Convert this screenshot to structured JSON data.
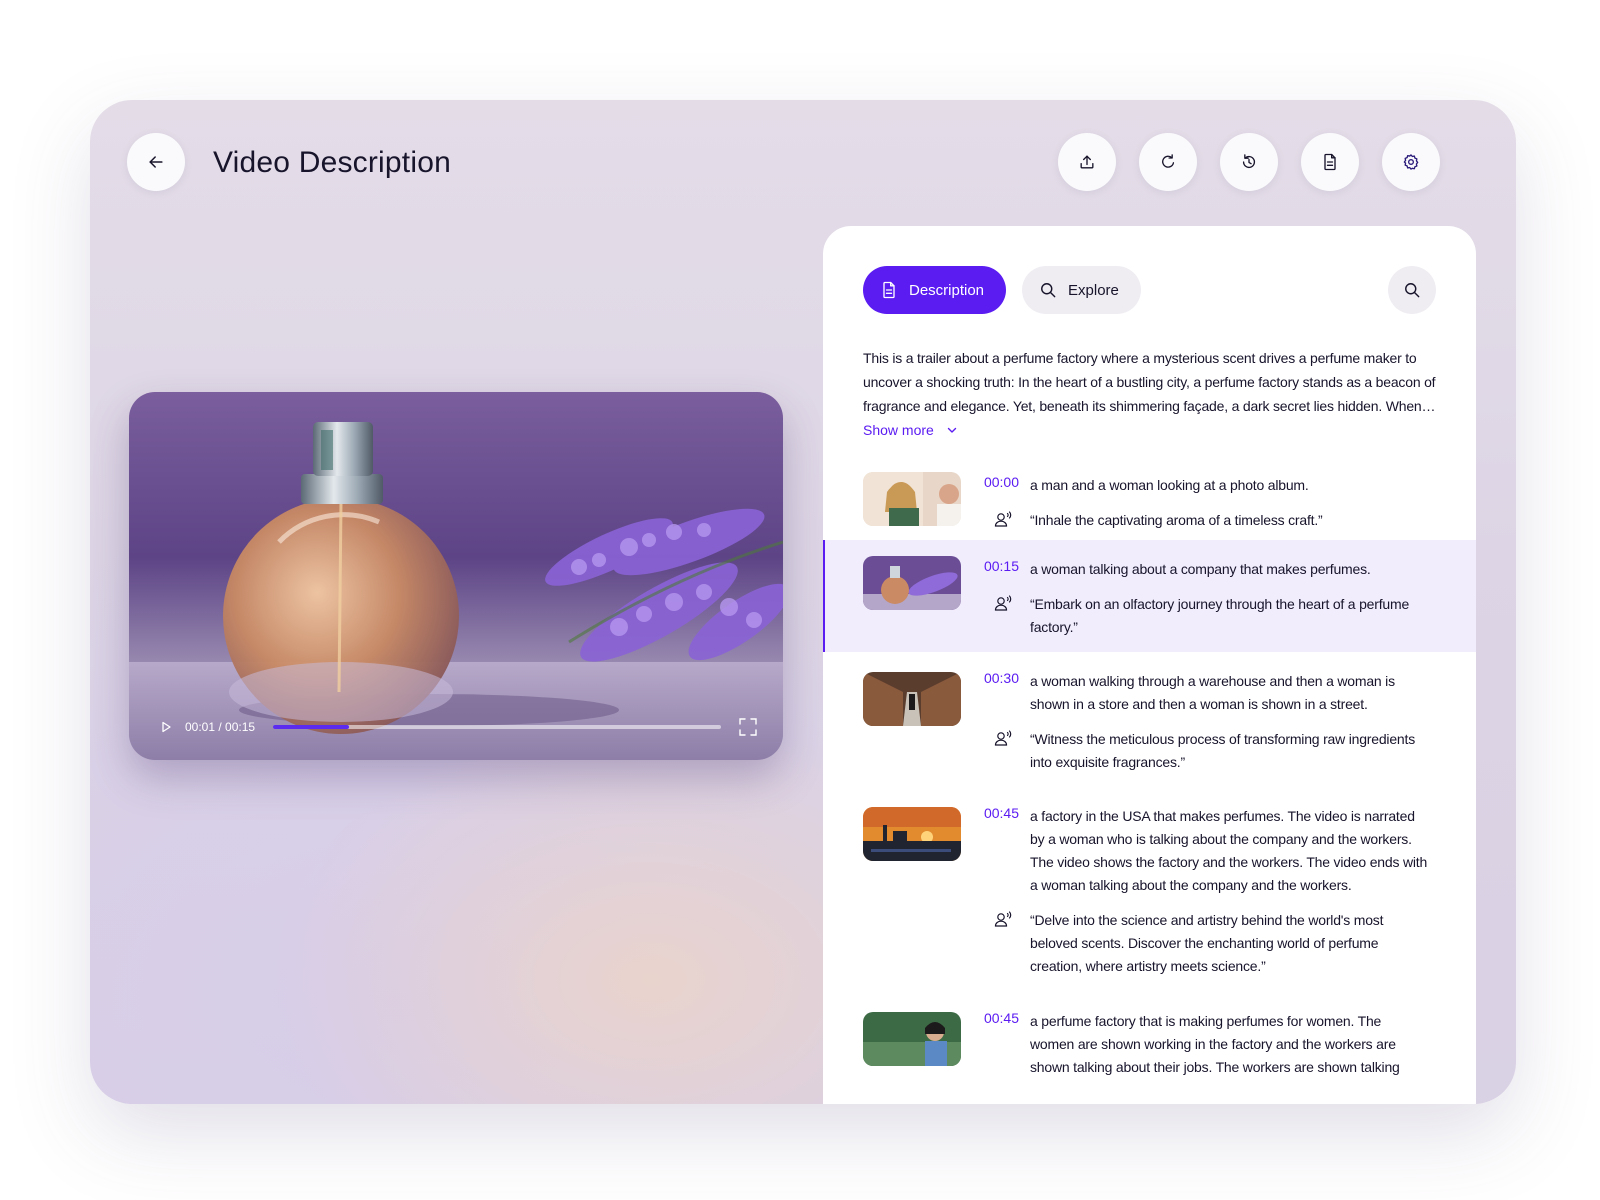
{
  "header": {
    "title": "Video Description",
    "back_icon": "arrow-left-icon",
    "actions": [
      {
        "name": "upload",
        "icon": "upload-icon"
      },
      {
        "name": "refresh",
        "icon": "refresh-icon"
      },
      {
        "name": "history",
        "icon": "history-icon"
      },
      {
        "name": "document",
        "icon": "document-icon"
      },
      {
        "name": "settings",
        "icon": "gear-icon"
      }
    ]
  },
  "player": {
    "time": "00:01 / 00:15",
    "progress": 0.17,
    "play_icon": "play-icon",
    "fullscreen_icon": "fullscreen-icon"
  },
  "panel": {
    "tabs": [
      {
        "label": "Description",
        "icon": "document-icon",
        "active": true
      },
      {
        "label": "Explore",
        "icon": "search-icon",
        "active": false
      }
    ],
    "search_icon": "search-icon",
    "summary": "This is a trailer about  a perfume factory where a mysterious scent drives a perfume maker to uncover a shocking truth: In the heart of a bustling city, a perfume factory stands as a beacon of fragrance and elegance. Yet, beneath its shimmering façade, a dark secret lies hidden. When…",
    "show_more": "Show more",
    "scenes": [
      {
        "time": "00:00",
        "description": "a man and a woman looking at a photo album.",
        "quote": "“Inhale the captivating aroma of a timeless craft.”",
        "active": false
      },
      {
        "time": "00:15",
        "description": "a woman talking about a company that makes perfumes.",
        "quote": "“Embark on an olfactory journey through the heart of a perfume factory.”",
        "active": true
      },
      {
        "time": "00:30",
        "description": "a woman walking through a warehouse and then a woman is shown in a store and then a woman is shown in a street.",
        "quote": "“Witness the meticulous process of transforming raw ingredients into exquisite fragrances.”",
        "active": false
      },
      {
        "time": "00:45",
        "description": "a factory in the USA that makes perfumes. The video is narrated by a woman who is talking about the company and the workers. The video shows the factory and the workers. The video ends with a woman talking about the company and the workers.",
        "quote": "“Delve into the science and artistry behind the world's most beloved scents. Discover the enchanting world of perfume creation, where artistry meets science.”",
        "active": false
      },
      {
        "time": "00:45",
        "description": "a perfume factory that is making perfumes for women. The women are shown working in the factory and the workers are shown talking about their jobs. The workers are shown talking",
        "quote": "",
        "active": false
      }
    ]
  },
  "colors": {
    "accent": "#5b1cf2",
    "active_row": "#f1edfd"
  }
}
